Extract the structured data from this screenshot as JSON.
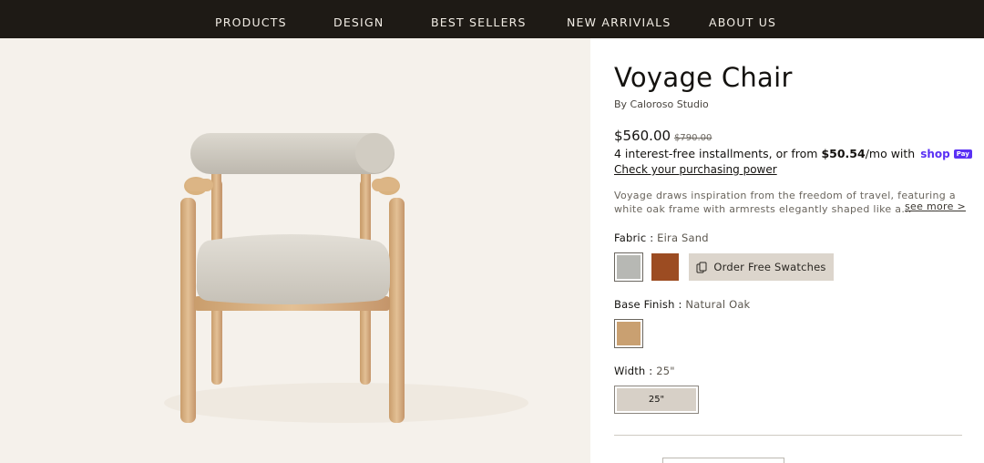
{
  "nav": {
    "items": [
      {
        "label": "PRODUCTS"
      },
      {
        "label": "DESIGN"
      },
      {
        "label": "BEST SELLERS"
      },
      {
        "label": "NEW ARRIVIALS"
      },
      {
        "label": "ABOUT US"
      }
    ]
  },
  "product": {
    "title": "Voyage Chair",
    "byline": "By Caloroso Studio",
    "price": "$560.00",
    "compare_price": "$790.00",
    "installments": {
      "prefix": "4 interest-free installments, or from",
      "amount": "$50.54",
      "suffix": "/mo with",
      "shop_logo": "shop",
      "pay_badge": "Pay"
    },
    "check_link": "Check your purchasing power",
    "description": {
      "line1": "Voyage draws inspiration from the freedom of travel, featuring a",
      "line2": "white oak frame with armrests elegantly shaped like a..."
    },
    "see_more": "see more >"
  },
  "fabric": {
    "label": "Fabric :",
    "value": "Eira Sand",
    "swatches": [
      {
        "name": "Eira Sand",
        "color": "#b7b8b4",
        "selected": true
      },
      {
        "name": "Rust",
        "color": "#9c4c22",
        "selected": false
      }
    ],
    "order_button": "Order Free Swatches",
    "order_icon": "swatches-icon"
  },
  "base_finish": {
    "label": "Base Finish :",
    "value": "Natural Oak",
    "swatches": [
      {
        "name": "Natural Oak",
        "color": "#c9a071",
        "selected": true
      }
    ]
  },
  "width": {
    "label": "Width :",
    "value": "25\"",
    "options": [
      {
        "label": "25\"",
        "selected": true
      }
    ]
  },
  "colors": {
    "nav_bg": "#1e1a15",
    "hero_bg": "#f5f1eb",
    "accent_shop": "#5a31f4"
  }
}
